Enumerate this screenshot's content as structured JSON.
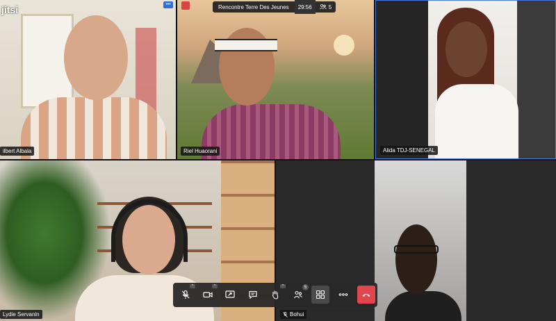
{
  "app": {
    "logo_text": "jitsi"
  },
  "meeting": {
    "title": "Rencontre Terre Des Jeunes",
    "elapsed": "29:56",
    "participant_count": "5"
  },
  "participants": [
    {
      "name": "ilbert Albala"
    },
    {
      "name": "Riel Huaorani"
    },
    {
      "name": "Alida TDJ-SENEGAL"
    },
    {
      "name": "Lydie Servanin"
    },
    {
      "name": "Bohui"
    }
  ],
  "toolbar": {
    "icons": [
      "mic-muted-icon",
      "camera-icon",
      "share-screen-icon",
      "chat-icon",
      "raise-hand-icon",
      "participants-icon",
      "tile-view-icon",
      "more-icon",
      "hangup-icon"
    ],
    "participants_badge": "5"
  },
  "colors": {
    "hangup": "#e0474c",
    "toolbar_bg": "#282828",
    "active_tile_border": "#4a78d8"
  }
}
